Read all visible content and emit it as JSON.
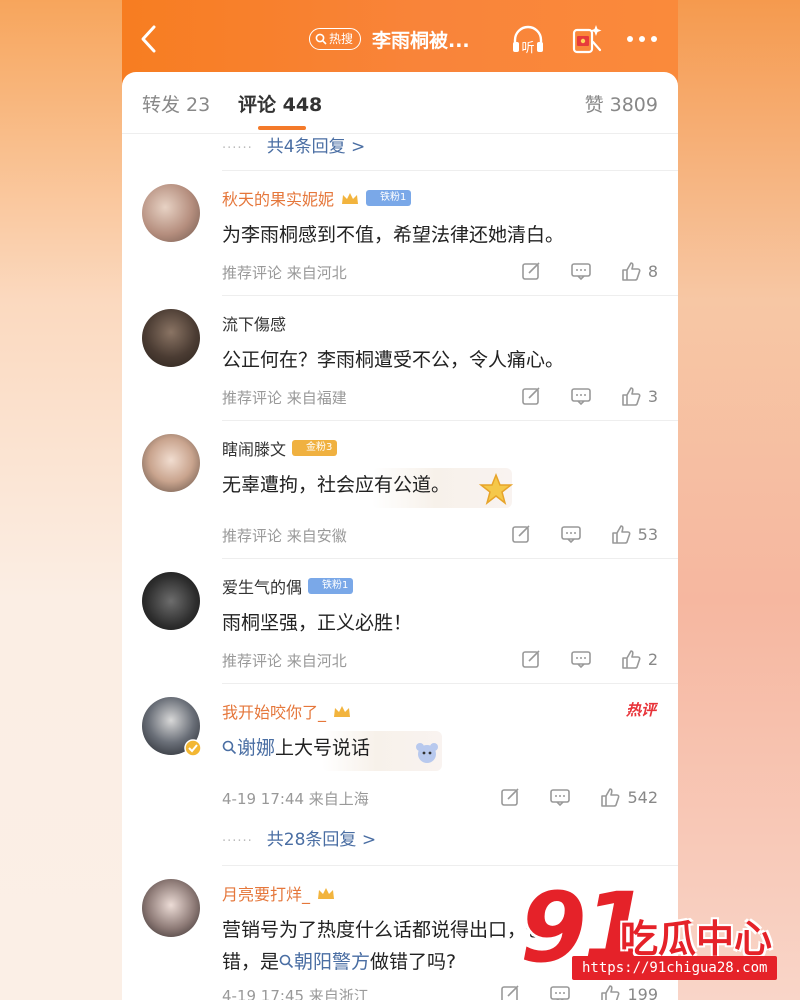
{
  "colors": {
    "accent": "#f47a2a",
    "link": "#4a6ea3",
    "hot": "#e8343a",
    "orange_name": "#e5773b"
  },
  "topbar": {
    "hot_badge_label": "热搜",
    "title": "李雨桐被...",
    "listen_label": "听"
  },
  "tabs": [
    {
      "label": "转发 23"
    },
    {
      "label": "评论 448"
    },
    {
      "label": "赞 3809"
    }
  ],
  "replies_top": {
    "label": "共4条回复 >"
  },
  "comments": [
    {
      "name": "秋天的果实妮妮",
      "badge": "铁粉1",
      "text": "为李雨桐感到不值，希望法律还她清白。",
      "meta": "推荐评论  来自河北",
      "likes": "8"
    },
    {
      "name": "流下傷感",
      "text": "公正何在？李雨桐遭受不公，令人痛心。",
      "meta": "推荐评论  来自福建",
      "likes": "3"
    },
    {
      "name": "瞎闹滕文",
      "badge": "金粉3",
      "text": "无辜遭拘，社会应有公道。",
      "meta": "推荐评论  来自安徽",
      "likes": "53"
    },
    {
      "name": "爱生气的偶",
      "badge": "铁粉1",
      "text": "雨桐坚强，正义必胜！",
      "meta": "推荐评论  来自河北",
      "likes": "2"
    },
    {
      "name": "我开始咬你了_",
      "hot_tag": "热评",
      "text_link": "谢娜",
      "text_rest": "上大号说话",
      "meta": "4-19 17:44  来自上海",
      "likes": "542",
      "replies": "共28条回复 >"
    },
    {
      "name": "月亮要打烊_",
      "text_line1": "营销号为了热度什么话都说得出口，也",
      "text_line2_a": "错，是",
      "text_line2_link": "朝阳警方",
      "text_line2_b": "做错了吗?",
      "meta": "4-19 17:45  来自浙江",
      "likes": "199"
    }
  ],
  "watermark": {
    "big": "91",
    "cn": "吃瓜中心",
    "url": "https://91chigua28.com"
  }
}
